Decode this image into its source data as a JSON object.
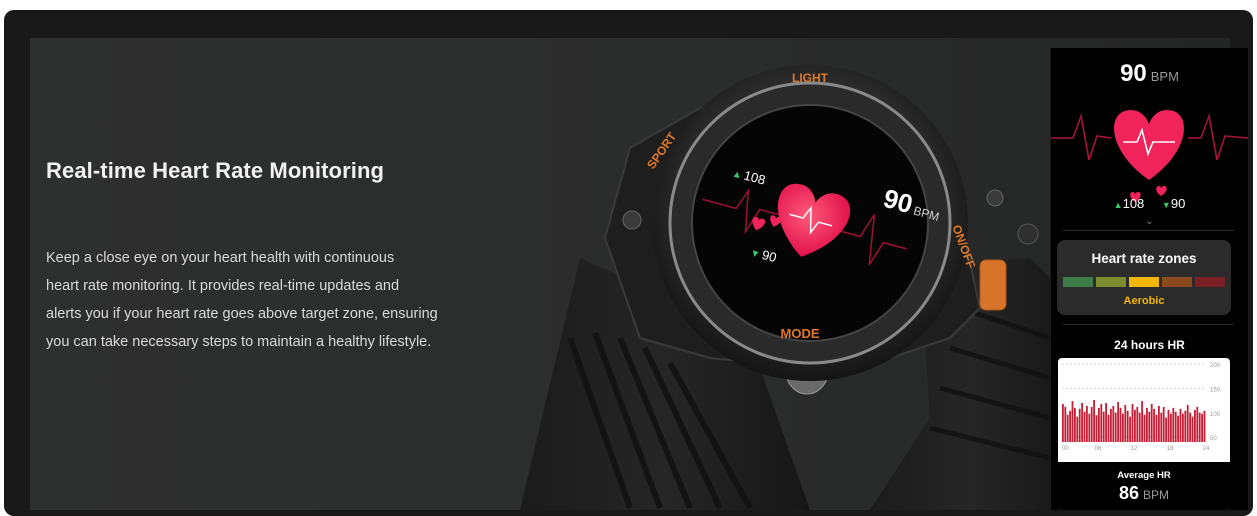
{
  "section": {
    "title": "Real-time Heart Rate Monitoring",
    "body_lines": [
      "Keep a close eye on your heart health with continuous",
      "heart rate monitoring. It provides real-time updates and",
      "alerts you if your heart rate goes above target zone, ensuring",
      "you can take necessary steps to maintain a healthy lifestyle."
    ]
  },
  "watch": {
    "bezel_top": "LIGHT",
    "bezel_left": "SPORT",
    "bezel_right": "ON/OFF",
    "bezel_bottom": "MODE",
    "bpm_value": "90",
    "bpm_unit": "BPM",
    "max_hr": "108",
    "min_hr": "90",
    "accent_color": "#e0782a",
    "heart_color": "#f0245a"
  },
  "phone": {
    "bpm_value": "90",
    "bpm_unit": "BPM",
    "max_hr": "108",
    "min_hr": "90",
    "zones": {
      "title": "Heart rate zones",
      "colors": [
        "#3e7d4a",
        "#7d8c2c",
        "#f2b705",
        "#8a4a1e",
        "#7a1f26"
      ],
      "active_label": "Aerobic",
      "active_index": 2
    },
    "hr24_title": "24 hours HR",
    "hr24_chart": {
      "y_ticks": [
        "200",
        "150",
        "100",
        "50"
      ],
      "x_ticks": [
        "00",
        "06",
        "12",
        "18",
        "24"
      ]
    },
    "average_label": "Average HR",
    "average_value": "86",
    "average_unit": "BPM"
  },
  "chart_data": {
    "type": "bar",
    "title": "24 hours HR",
    "ylim": [
      40,
      200
    ],
    "x_range": [
      0,
      24
    ],
    "y_ticks": [
      200,
      150,
      100,
      50
    ],
    "x_ticks": [
      "00",
      "06",
      "12",
      "18",
      "24"
    ],
    "values": [
      118,
      112,
      96,
      104,
      124,
      110,
      92,
      108,
      120,
      102,
      114,
      98,
      112,
      126,
      95,
      110,
      118,
      102,
      120,
      96,
      108,
      114,
      100,
      122,
      110,
      98,
      116,
      104,
      92,
      118,
      106,
      112,
      100,
      124,
      96,
      110,
      102,
      118,
      108,
      96,
      114,
      100,
      112,
      90,
      106,
      98,
      110,
      102,
      94,
      108,
      98,
      104,
      116,
      100,
      92,
      106,
      112,
      100,
      98,
      104
    ]
  }
}
